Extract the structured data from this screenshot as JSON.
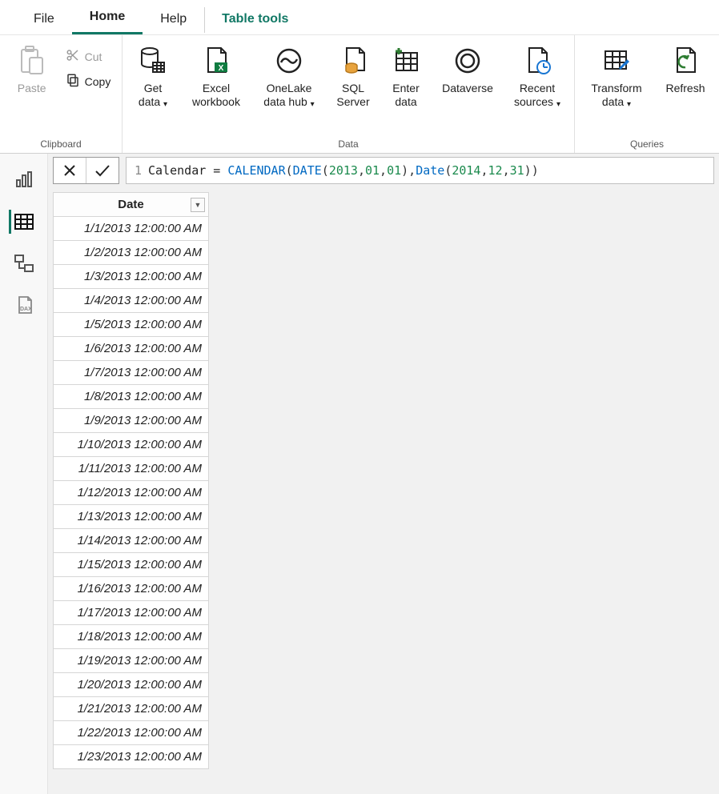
{
  "tabs": {
    "file": "File",
    "home": "Home",
    "help": "Help",
    "table_tools": "Table tools"
  },
  "ribbon": {
    "clipboard": {
      "label": "Clipboard",
      "paste": "Paste",
      "cut": "Cut",
      "copy": "Copy"
    },
    "data": {
      "label": "Data",
      "get_data": "Get\ndata",
      "excel": "Excel\nworkbook",
      "onelake": "OneLake\ndata hub",
      "sql": "SQL\nServer",
      "enter": "Enter\ndata",
      "dataverse": "Dataverse",
      "recent": "Recent\nsources"
    },
    "queries": {
      "label": "Queries",
      "transform": "Transform\ndata",
      "refresh": "Refresh"
    }
  },
  "formula": {
    "line_no": "1",
    "text_plain": "Calendar = CALENDAR(DATE(2013,01,01),Date(2014,12,31))",
    "tokens": {
      "a": "Calendar = ",
      "fn1": "CALENDAR",
      "p1": "(",
      "fn2": "DATE",
      "p2": "(",
      "n1": "2013",
      "c1": ",",
      "n2": "01",
      "c2": ",",
      "n3": "01",
      "p3": ")",
      "c3": ",",
      "fn3": "Date",
      "p4": "(",
      "n4": "2014",
      "c4": ",",
      "n5": "12",
      "c5": ",",
      "n6": "31",
      "p5": ")",
      "p6": ")"
    }
  },
  "table": {
    "column_header": "Date",
    "rows": [
      "1/1/2013 12:00:00 AM",
      "1/2/2013 12:00:00 AM",
      "1/3/2013 12:00:00 AM",
      "1/4/2013 12:00:00 AM",
      "1/5/2013 12:00:00 AM",
      "1/6/2013 12:00:00 AM",
      "1/7/2013 12:00:00 AM",
      "1/8/2013 12:00:00 AM",
      "1/9/2013 12:00:00 AM",
      "1/10/2013 12:00:00 AM",
      "1/11/2013 12:00:00 AM",
      "1/12/2013 12:00:00 AM",
      "1/13/2013 12:00:00 AM",
      "1/14/2013 12:00:00 AM",
      "1/15/2013 12:00:00 AM",
      "1/16/2013 12:00:00 AM",
      "1/17/2013 12:00:00 AM",
      "1/18/2013 12:00:00 AM",
      "1/19/2013 12:00:00 AM",
      "1/20/2013 12:00:00 AM",
      "1/21/2013 12:00:00 AM",
      "1/22/2013 12:00:00 AM",
      "1/23/2013 12:00:00 AM"
    ]
  }
}
